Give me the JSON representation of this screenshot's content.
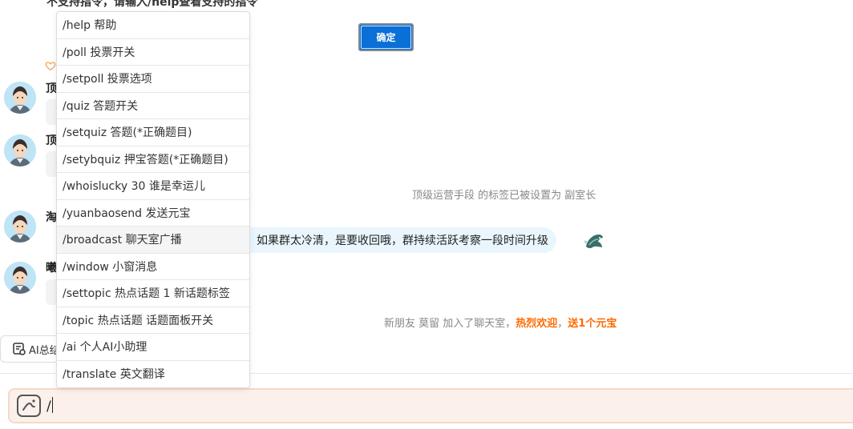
{
  "top_notice": "不支持指令，请输入/help查看支持的指令",
  "confirm_button": "确定",
  "nicknames": [
    "顶",
    "顶",
    "淘",
    "曦"
  ],
  "system_messages": {
    "role_set": "顶级运营手段 的标签已被设置为 副室长",
    "new_friend_prefix": "新朋友 莫留 加入了聊天室，",
    "welcome": "热烈欢迎",
    "comma": "，",
    "gift": "送1个元宝"
  },
  "chat_message": "如果群太冷清，是要收回哦，群持续活跃考察一段时间升级",
  "ai_summary_label": "AI总结",
  "input": {
    "value": "/"
  },
  "command_menu": {
    "items": [
      "/help 帮助",
      "/poll 投票开关",
      "/setpoll 投票选项",
      "/quiz 答题开关",
      "/setquiz 答题(*正确题目)",
      "/setybquiz 押宝答题(*正确题目)",
      "/whoislucky 30 谁是幸运儿",
      "/yuanbaosend 发送元宝",
      "/broadcast 聊天室广播",
      "/window 小窗消息",
      "/settopic 热点话题 1 新话题标签",
      "/topic 热点话题 话题面板开关",
      "/ai 个人AI小助理",
      "/translate 英文翻译"
    ],
    "active_index": 8
  },
  "colors": {
    "accent_blue": "#0a6fd6",
    "highlight_orange": "#ff6a00",
    "input_bg": "#fbf1ea"
  }
}
